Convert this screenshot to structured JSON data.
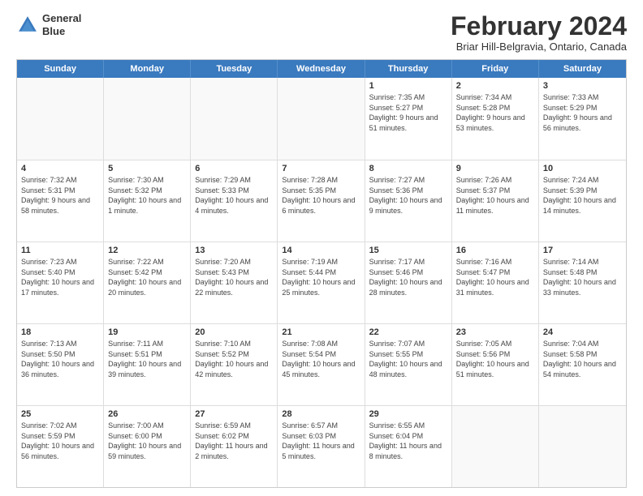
{
  "header": {
    "logo_line1": "General",
    "logo_line2": "Blue",
    "month": "February 2024",
    "location": "Briar Hill-Belgravia, Ontario, Canada"
  },
  "days_of_week": [
    "Sunday",
    "Monday",
    "Tuesday",
    "Wednesday",
    "Thursday",
    "Friday",
    "Saturday"
  ],
  "weeks": [
    [
      {
        "day": "",
        "info": ""
      },
      {
        "day": "",
        "info": ""
      },
      {
        "day": "",
        "info": ""
      },
      {
        "day": "",
        "info": ""
      },
      {
        "day": "1",
        "info": "Sunrise: 7:35 AM\nSunset: 5:27 PM\nDaylight: 9 hours and 51 minutes."
      },
      {
        "day": "2",
        "info": "Sunrise: 7:34 AM\nSunset: 5:28 PM\nDaylight: 9 hours and 53 minutes."
      },
      {
        "day": "3",
        "info": "Sunrise: 7:33 AM\nSunset: 5:29 PM\nDaylight: 9 hours and 56 minutes."
      }
    ],
    [
      {
        "day": "4",
        "info": "Sunrise: 7:32 AM\nSunset: 5:31 PM\nDaylight: 9 hours and 58 minutes."
      },
      {
        "day": "5",
        "info": "Sunrise: 7:30 AM\nSunset: 5:32 PM\nDaylight: 10 hours and 1 minute."
      },
      {
        "day": "6",
        "info": "Sunrise: 7:29 AM\nSunset: 5:33 PM\nDaylight: 10 hours and 4 minutes."
      },
      {
        "day": "7",
        "info": "Sunrise: 7:28 AM\nSunset: 5:35 PM\nDaylight: 10 hours and 6 minutes."
      },
      {
        "day": "8",
        "info": "Sunrise: 7:27 AM\nSunset: 5:36 PM\nDaylight: 10 hours and 9 minutes."
      },
      {
        "day": "9",
        "info": "Sunrise: 7:26 AM\nSunset: 5:37 PM\nDaylight: 10 hours and 11 minutes."
      },
      {
        "day": "10",
        "info": "Sunrise: 7:24 AM\nSunset: 5:39 PM\nDaylight: 10 hours and 14 minutes."
      }
    ],
    [
      {
        "day": "11",
        "info": "Sunrise: 7:23 AM\nSunset: 5:40 PM\nDaylight: 10 hours and 17 minutes."
      },
      {
        "day": "12",
        "info": "Sunrise: 7:22 AM\nSunset: 5:42 PM\nDaylight: 10 hours and 20 minutes."
      },
      {
        "day": "13",
        "info": "Sunrise: 7:20 AM\nSunset: 5:43 PM\nDaylight: 10 hours and 22 minutes."
      },
      {
        "day": "14",
        "info": "Sunrise: 7:19 AM\nSunset: 5:44 PM\nDaylight: 10 hours and 25 minutes."
      },
      {
        "day": "15",
        "info": "Sunrise: 7:17 AM\nSunset: 5:46 PM\nDaylight: 10 hours and 28 minutes."
      },
      {
        "day": "16",
        "info": "Sunrise: 7:16 AM\nSunset: 5:47 PM\nDaylight: 10 hours and 31 minutes."
      },
      {
        "day": "17",
        "info": "Sunrise: 7:14 AM\nSunset: 5:48 PM\nDaylight: 10 hours and 33 minutes."
      }
    ],
    [
      {
        "day": "18",
        "info": "Sunrise: 7:13 AM\nSunset: 5:50 PM\nDaylight: 10 hours and 36 minutes."
      },
      {
        "day": "19",
        "info": "Sunrise: 7:11 AM\nSunset: 5:51 PM\nDaylight: 10 hours and 39 minutes."
      },
      {
        "day": "20",
        "info": "Sunrise: 7:10 AM\nSunset: 5:52 PM\nDaylight: 10 hours and 42 minutes."
      },
      {
        "day": "21",
        "info": "Sunrise: 7:08 AM\nSunset: 5:54 PM\nDaylight: 10 hours and 45 minutes."
      },
      {
        "day": "22",
        "info": "Sunrise: 7:07 AM\nSunset: 5:55 PM\nDaylight: 10 hours and 48 minutes."
      },
      {
        "day": "23",
        "info": "Sunrise: 7:05 AM\nSunset: 5:56 PM\nDaylight: 10 hours and 51 minutes."
      },
      {
        "day": "24",
        "info": "Sunrise: 7:04 AM\nSunset: 5:58 PM\nDaylight: 10 hours and 54 minutes."
      }
    ],
    [
      {
        "day": "25",
        "info": "Sunrise: 7:02 AM\nSunset: 5:59 PM\nDaylight: 10 hours and 56 minutes."
      },
      {
        "day": "26",
        "info": "Sunrise: 7:00 AM\nSunset: 6:00 PM\nDaylight: 10 hours and 59 minutes."
      },
      {
        "day": "27",
        "info": "Sunrise: 6:59 AM\nSunset: 6:02 PM\nDaylight: 11 hours and 2 minutes."
      },
      {
        "day": "28",
        "info": "Sunrise: 6:57 AM\nSunset: 6:03 PM\nDaylight: 11 hours and 5 minutes."
      },
      {
        "day": "29",
        "info": "Sunrise: 6:55 AM\nSunset: 6:04 PM\nDaylight: 11 hours and 8 minutes."
      },
      {
        "day": "",
        "info": ""
      },
      {
        "day": "",
        "info": ""
      }
    ]
  ]
}
